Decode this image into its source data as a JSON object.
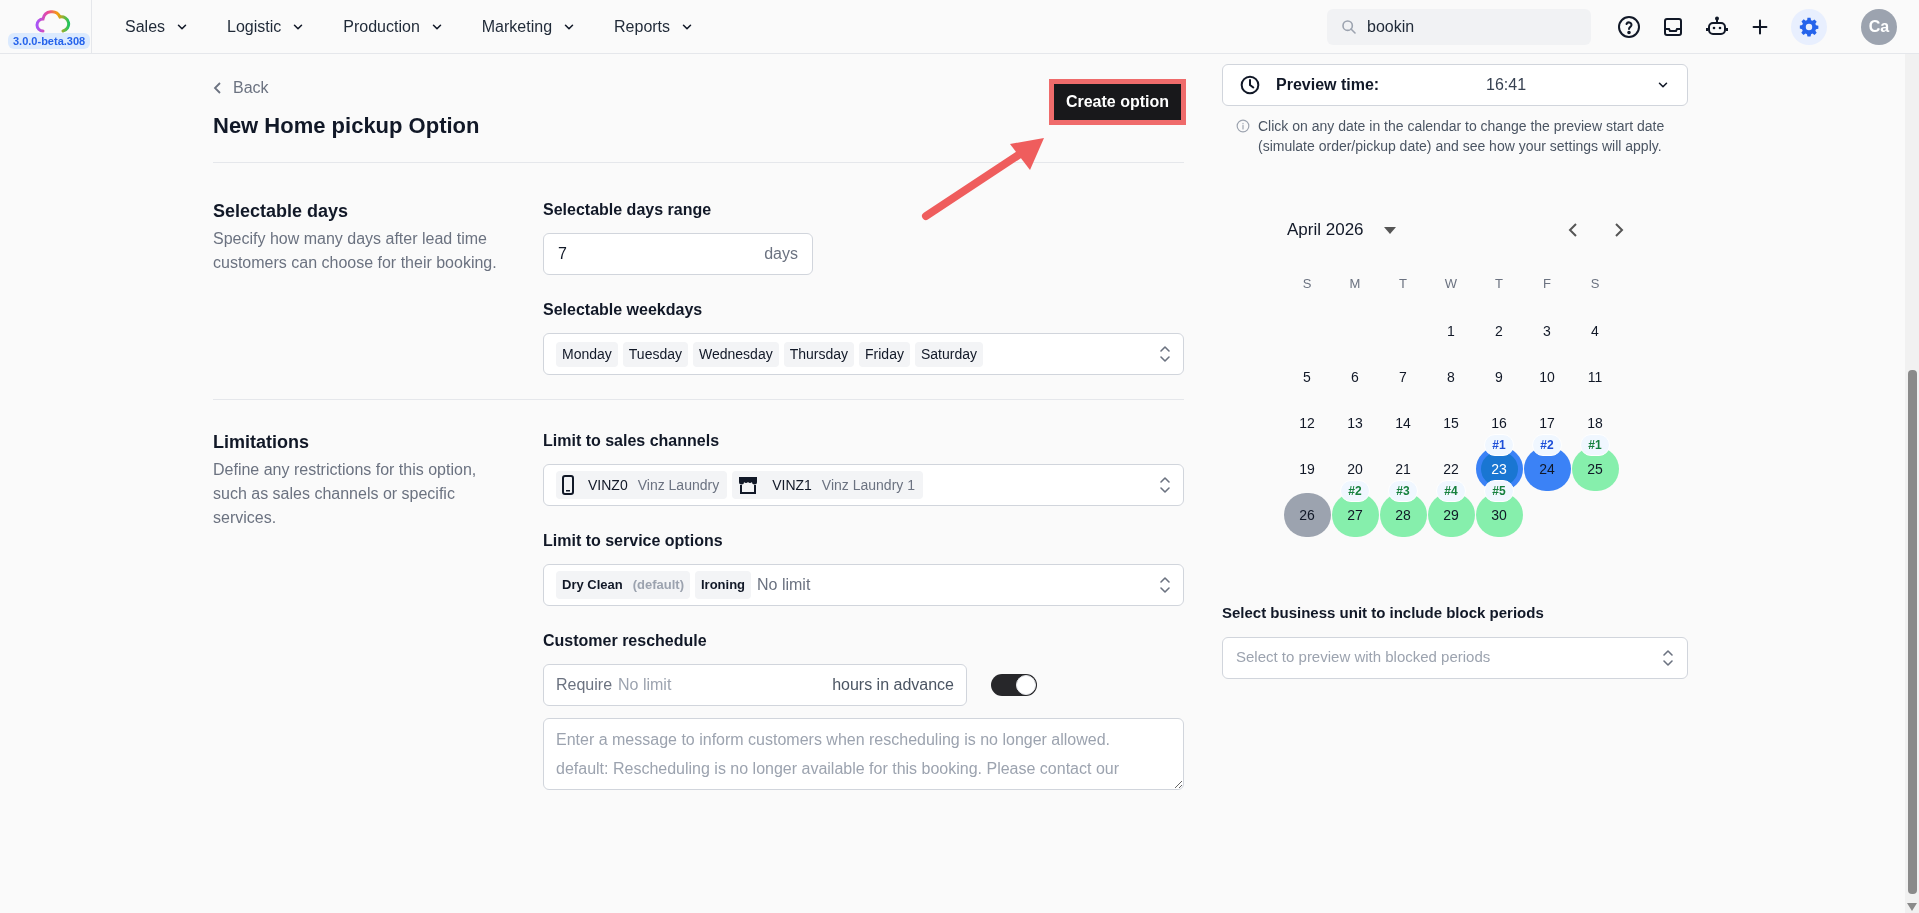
{
  "header": {
    "version": "3.0.0-beta.308",
    "nav": [
      {
        "label": "Sales"
      },
      {
        "label": "Logistic"
      },
      {
        "label": "Production"
      },
      {
        "label": "Marketing"
      },
      {
        "label": "Reports"
      }
    ],
    "search": {
      "value": "bookin"
    },
    "avatar": "Ca"
  },
  "page": {
    "back": "Back",
    "title": "New **Home pickup** Option",
    "create_button": "Create option"
  },
  "sections": [
    {
      "title": "Selectable days",
      "description": "Specify how many days after lead time customers can choose for their booking.",
      "fields": [
        {
          "kind": "number",
          "label": "Selectable days range",
          "value": "7",
          "suffix": "days"
        },
        {
          "kind": "tags",
          "label": "Selectable weekdays",
          "tags": [
            {
              "label": "Monday"
            },
            {
              "label": "Tuesday"
            },
            {
              "label": "Wednesday"
            },
            {
              "label": "Thursday"
            },
            {
              "label": "Friday"
            },
            {
              "label": "Saturday"
            }
          ]
        }
      ]
    },
    {
      "title": "Limitations",
      "description": "Define any restrictions for this option, such as sales channels or specific services.",
      "fields": [
        {
          "kind": "channels",
          "label": "Limit to sales channels",
          "tags": [
            {
              "kind": "phone",
              "code": "VINZ0",
              "name": "Vinz Laundry"
            },
            {
              "kind": "store",
              "code": "VINZ1",
              "name": "Vinz Laundry 1"
            }
          ]
        },
        {
          "kind": "services",
          "label": "Limit to service options",
          "tags": [
            {
              "label": "Dry Clean",
              "note": "(default)"
            },
            {
              "label": "Ironing"
            }
          ],
          "placeholder": "No limit"
        },
        {
          "kind": "reschedule",
          "label": "Customer reschedule",
          "prefix": "Require",
          "placeholder": "No limit",
          "suffix": "hours in advance",
          "on": true,
          "message_placeholder": "Enter a message to inform customers when rescheduling is no longer allowed.\ndefault: Rescheduling is no longer available for this booking. Please contact our"
        }
      ]
    }
  ],
  "preview": {
    "label": "Preview time:",
    "time": "16:41",
    "info": "Click on any date in the calendar to change the preview start date (simulate order/pickup date) and see how your settings will apply.",
    "calendar": {
      "month": "April 2026",
      "weekdays": [
        "S",
        "M",
        "T",
        "W",
        "T",
        "F",
        "S"
      ],
      "weeks": [
        [
          {
            "kind": "blank"
          },
          {
            "kind": "blank"
          },
          {
            "kind": "blank"
          },
          {
            "kind": "day",
            "day": "1"
          },
          {
            "kind": "day",
            "day": "2"
          },
          {
            "kind": "day",
            "day": "3"
          },
          {
            "kind": "day",
            "day": "4"
          }
        ],
        [
          {
            "kind": "day",
            "day": "5"
          },
          {
            "kind": "day",
            "day": "6"
          },
          {
            "kind": "day",
            "day": "7"
          },
          {
            "kind": "day",
            "day": "8"
          },
          {
            "kind": "day",
            "day": "9"
          },
          {
            "kind": "day",
            "day": "10"
          },
          {
            "kind": "day",
            "day": "11"
          }
        ],
        [
          {
            "kind": "day",
            "day": "12"
          },
          {
            "kind": "day",
            "day": "13"
          },
          {
            "kind": "day",
            "day": "14"
          },
          {
            "kind": "day",
            "day": "15"
          },
          {
            "kind": "day",
            "day": "16"
          },
          {
            "kind": "day",
            "day": "17"
          },
          {
            "kind": "day",
            "day": "18"
          }
        ],
        [
          {
            "kind": "day",
            "day": "19"
          },
          {
            "kind": "day",
            "day": "20"
          },
          {
            "kind": "day",
            "day": "21"
          },
          {
            "kind": "day",
            "day": "22"
          },
          {
            "kind": "marked",
            "day": "23",
            "color": "#1976d2",
            "selected": true,
            "badge": "#1"
          },
          {
            "kind": "marked",
            "day": "24",
            "color": "#3b82f6",
            "selected": false,
            "badge": "#2"
          },
          {
            "kind": "marked",
            "day": "25",
            "color": "#86efac",
            "selected": false,
            "badge": "#1"
          }
        ],
        [
          {
            "kind": "marked",
            "day": "26",
            "color": "#9ca3af",
            "selected": false
          },
          {
            "kind": "marked",
            "day": "27",
            "color": "#86efac",
            "selected": false,
            "badge": "#2"
          },
          {
            "kind": "marked",
            "day": "28",
            "color": "#86efac",
            "selected": false,
            "badge": "#3"
          },
          {
            "kind": "marked",
            "day": "29",
            "color": "#86efac",
            "selected": false,
            "badge": "#4"
          },
          {
            "kind": "marked",
            "day": "30",
            "color": "#86efac",
            "selected": false,
            "badge": "#5"
          }
        ]
      ]
    },
    "business_unit": {
      "label": "Select business unit to include block periods",
      "placeholder": "Select to preview with blocked periods"
    }
  }
}
